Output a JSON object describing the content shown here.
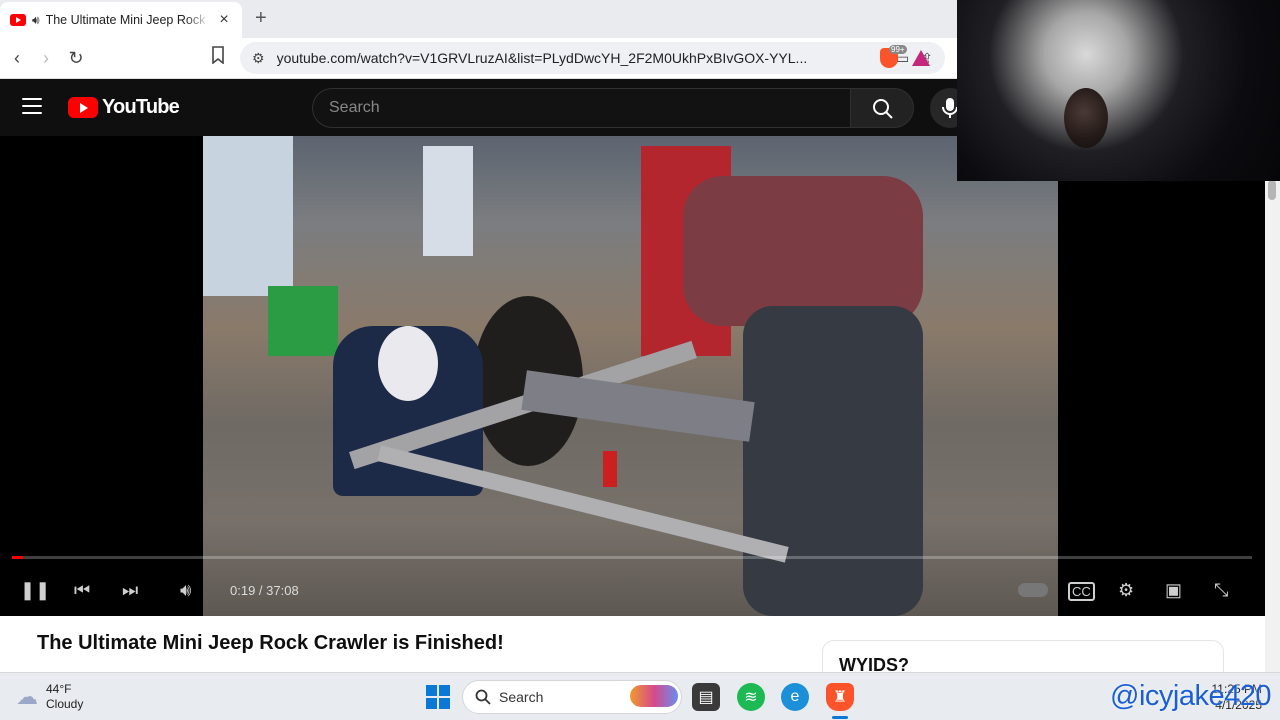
{
  "browser": {
    "tab_title": "The Ultimate Mini Jeep Rock Crawler is Finished!",
    "tab_close": "×",
    "new_tab": "+",
    "url": "youtube.com/watch?v=V1GRVLruzAI&list=PLydDwcYH_2F2M0UkhPxBIvGOX-YYL...",
    "brave_badge": "99+"
  },
  "youtube": {
    "logo_text": "YouTube",
    "search_placeholder": "Search"
  },
  "player": {
    "time": "0:19 / 37:08",
    "progress_fraction": 0.009
  },
  "video": {
    "title": "The Ultimate Mini Jeep Rock Crawler is Finished!"
  },
  "sidebar": {
    "card_text": "WYIDS?"
  },
  "taskbar": {
    "temp": "44°F",
    "condition": "Cloudy",
    "search_label": "Search",
    "time": "11:25 PM",
    "date": "4/1/2025"
  },
  "overlay": {
    "watermark": "@icyjake420"
  },
  "colors": {
    "youtube_red": "#ff0000",
    "windows_blue": "#0a78d4",
    "spotify_green": "#1db954",
    "brave_orange": "#fb542b"
  }
}
